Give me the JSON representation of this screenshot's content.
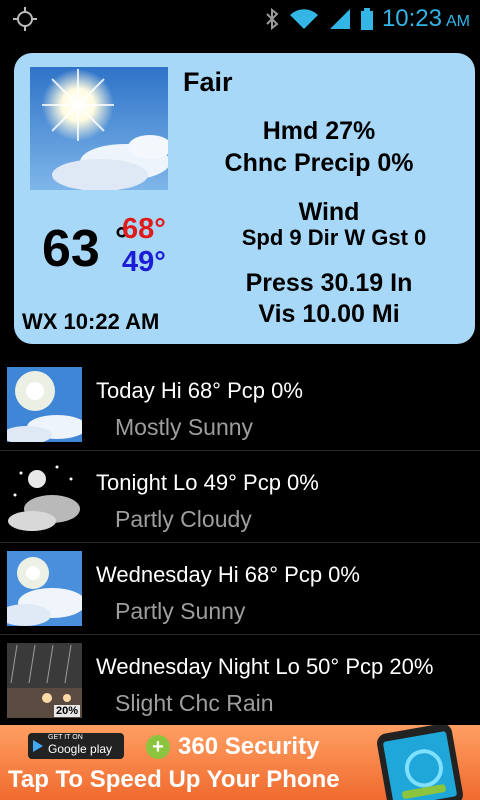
{
  "status_bar": {
    "time": "10:23",
    "ampm": "AM",
    "accent_color": "#33b5e5",
    "icons": [
      "gps-icon",
      "bluetooth-icon",
      "wifi-icon",
      "signal-icon",
      "battery-icon"
    ]
  },
  "current": {
    "condition": "Fair",
    "humidity": "Hmd  27%",
    "precip_chance": "Chnc Precip  0%",
    "wind_title": "Wind",
    "wind_detail": "Spd 9  Dir W  Gst 0",
    "pressure": "Press 30.19 In",
    "visibility": "Vis 10.00 Mi",
    "temp": "63",
    "deg_symbol": "°",
    "hi": "68°",
    "lo": "49°",
    "updated": "WX 10:22 AM",
    "card_color": "#a8d8f8",
    "hi_color": "#e01b1b",
    "lo_color": "#1d1dd8"
  },
  "forecast": [
    {
      "title": "Today  Hi 68°  Pcp 0%",
      "desc": "Mostly Sunny",
      "icon": "sunny-icon"
    },
    {
      "title": "Tonight  Lo 49°  Pcp 0%",
      "desc": "Partly Cloudy",
      "icon": "night-cloudy-icon"
    },
    {
      "title": "Wednesday  Hi 68°  Pcp 0%",
      "desc": "Partly Sunny",
      "icon": "partly-sunny-icon"
    },
    {
      "title": "Wednesday Night  Lo 50°  Pcp 20%",
      "desc": "Slight Chc Rain",
      "icon": "rain-icon",
      "badge": "20%"
    }
  ],
  "ad": {
    "getit": "GET IT ON",
    "store": "Google play",
    "plus": "+",
    "brand": "360 Security",
    "cta": "Tap To Speed Up Your Phone"
  }
}
